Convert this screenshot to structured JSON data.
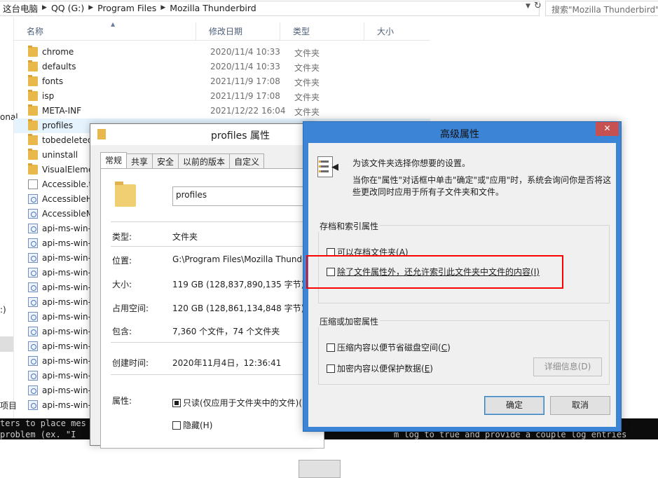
{
  "address": {
    "crumbs": [
      "这台电脑",
      "QQ (G:)",
      "Program Files",
      "Mozilla Thunderbird"
    ],
    "search_placeholder": "搜索\"Mozilla Thunderbird\""
  },
  "nav": {
    "frag_onal": "onal",
    "frag_paren": ":)",
    "frag_items": "项目"
  },
  "columns": {
    "name": "名称",
    "date": "修改日期",
    "type": "类型",
    "size": "大小"
  },
  "files": [
    {
      "name": "chrome",
      "date": "2020/11/4 10:33",
      "type": "文件夹",
      "icon": "folder-icon"
    },
    {
      "name": "defaults",
      "date": "2020/11/4 10:33",
      "type": "文件夹",
      "icon": "folder-icon"
    },
    {
      "name": "fonts",
      "date": "2021/11/9 17:08",
      "type": "文件夹",
      "icon": "folder-icon"
    },
    {
      "name": "isp",
      "date": "2021/11/9 17:08",
      "type": "文件夹",
      "icon": "folder-icon"
    },
    {
      "name": "META-INF",
      "date": "2021/12/22 16:04",
      "type": "文件夹",
      "icon": "folder-icon"
    },
    {
      "name": "profiles",
      "date": "",
      "type": "",
      "icon": "folder-icon"
    },
    {
      "name": "tobedeleted",
      "date": "",
      "type": "",
      "icon": "folder-icon"
    },
    {
      "name": "uninstall",
      "date": "",
      "type": "",
      "icon": "folder-icon"
    },
    {
      "name": "VisualEleme",
      "date": "",
      "type": "",
      "icon": "folder-icon"
    },
    {
      "name": "Accessible.t",
      "date": "",
      "type": "",
      "icon": "document-icon"
    },
    {
      "name": "AccessibleH",
      "date": "",
      "type": "",
      "icon": "dll-icon"
    },
    {
      "name": "AccessibleM",
      "date": "",
      "type": "",
      "icon": "dll-icon"
    },
    {
      "name": "api-ms-win-",
      "date": "",
      "type": "",
      "icon": "dll-icon"
    },
    {
      "name": "api-ms-win-",
      "date": "",
      "type": "",
      "icon": "dll-icon"
    },
    {
      "name": "api-ms-win-",
      "date": "",
      "type": "",
      "icon": "dll-icon"
    },
    {
      "name": "api-ms-win-",
      "date": "",
      "type": "",
      "icon": "dll-icon"
    },
    {
      "name": "api-ms-win-",
      "date": "",
      "type": "",
      "icon": "dll-icon"
    },
    {
      "name": "api-ms-win-",
      "date": "",
      "type": "",
      "icon": "dll-icon"
    },
    {
      "name": "api-ms-win-",
      "date": "",
      "type": "",
      "icon": "dll-icon"
    },
    {
      "name": "api-ms-win-",
      "date": "",
      "type": "",
      "icon": "dll-icon"
    },
    {
      "name": "api-ms-win-",
      "date": "",
      "type": "",
      "icon": "dll-icon"
    },
    {
      "name": "api-ms-win-",
      "date": "",
      "type": "",
      "icon": "dll-icon"
    },
    {
      "name": "api-ms-win-",
      "date": "",
      "type": "",
      "icon": "dll-icon"
    },
    {
      "name": "api-ms-win-",
      "date": "",
      "type": "",
      "icon": "dll-icon"
    },
    {
      "name": "api-ms-win-",
      "date": "",
      "type": "",
      "icon": "dll-icon"
    }
  ],
  "selected_file": "profiles",
  "console": {
    "line1": "ters to place mes",
    "line2": "problem (ex. \"I",
    "line3": "m log to true and provide a couple log entries"
  },
  "properties": {
    "title": "profiles 属性",
    "tabs": [
      "常规",
      "共享",
      "安全",
      "以前的版本",
      "自定义"
    ],
    "active_tab": "常规",
    "folder_name": "profiles",
    "type_label": "类型:",
    "type_value": "文件夹",
    "location_label": "位置:",
    "location_value": "G:\\Program Files\\Mozilla Thunde",
    "size_label": "大小:",
    "size_value": "119 GB (128,837,890,135 字节)",
    "disk_label": "占用空间:",
    "disk_value": "120 GB (128,861,134,848 字节)",
    "contains_label": "包含:",
    "contains_value": "7,360 个文件，74 个文件夹",
    "created_label": "创建时间:",
    "created_value": "2020年11月4日，12:36:41",
    "attr_label": "属性:",
    "readonly_label": "只读(仅应用于文件夹中的文件)(R",
    "hidden_label": "隐藏(H)"
  },
  "advanced": {
    "title": "高级属性",
    "close_symbol": "✕",
    "intro": "为该文件夹选择你想要的设置。",
    "description": "当你在\"属性\"对话框中单击\"确定\"或\"应用\"时，系统会询问你是否将这些更改同时应用于所有子文件夹和文件。",
    "archive_group": "存档和索引属性",
    "archive_option_text": "可以存档文件夹(",
    "archive_option_key": "A",
    "archive_option_end": ")",
    "index_option_text": "除了文件属性外，还允许索引此文件夹中文件的内容(",
    "index_option_key": "I",
    "index_option_end": ")",
    "compress_group": "压缩或加密属性",
    "compress_option_text": "压缩内容以便节省磁盘空间(",
    "compress_option_key": "C",
    "compress_option_end": ")",
    "encrypt_option_text": "加密内容以便保护数据(",
    "encrypt_option_key": "E",
    "encrypt_option_end": ")",
    "details_button": "详细信息(D)",
    "ok_button": "确定",
    "cancel_button": "取消"
  },
  "colors": {
    "accent": "#3c84d6",
    "highlight_box": "#ff0000",
    "close_button": "#c75050",
    "selection": "#e5f3ff"
  }
}
